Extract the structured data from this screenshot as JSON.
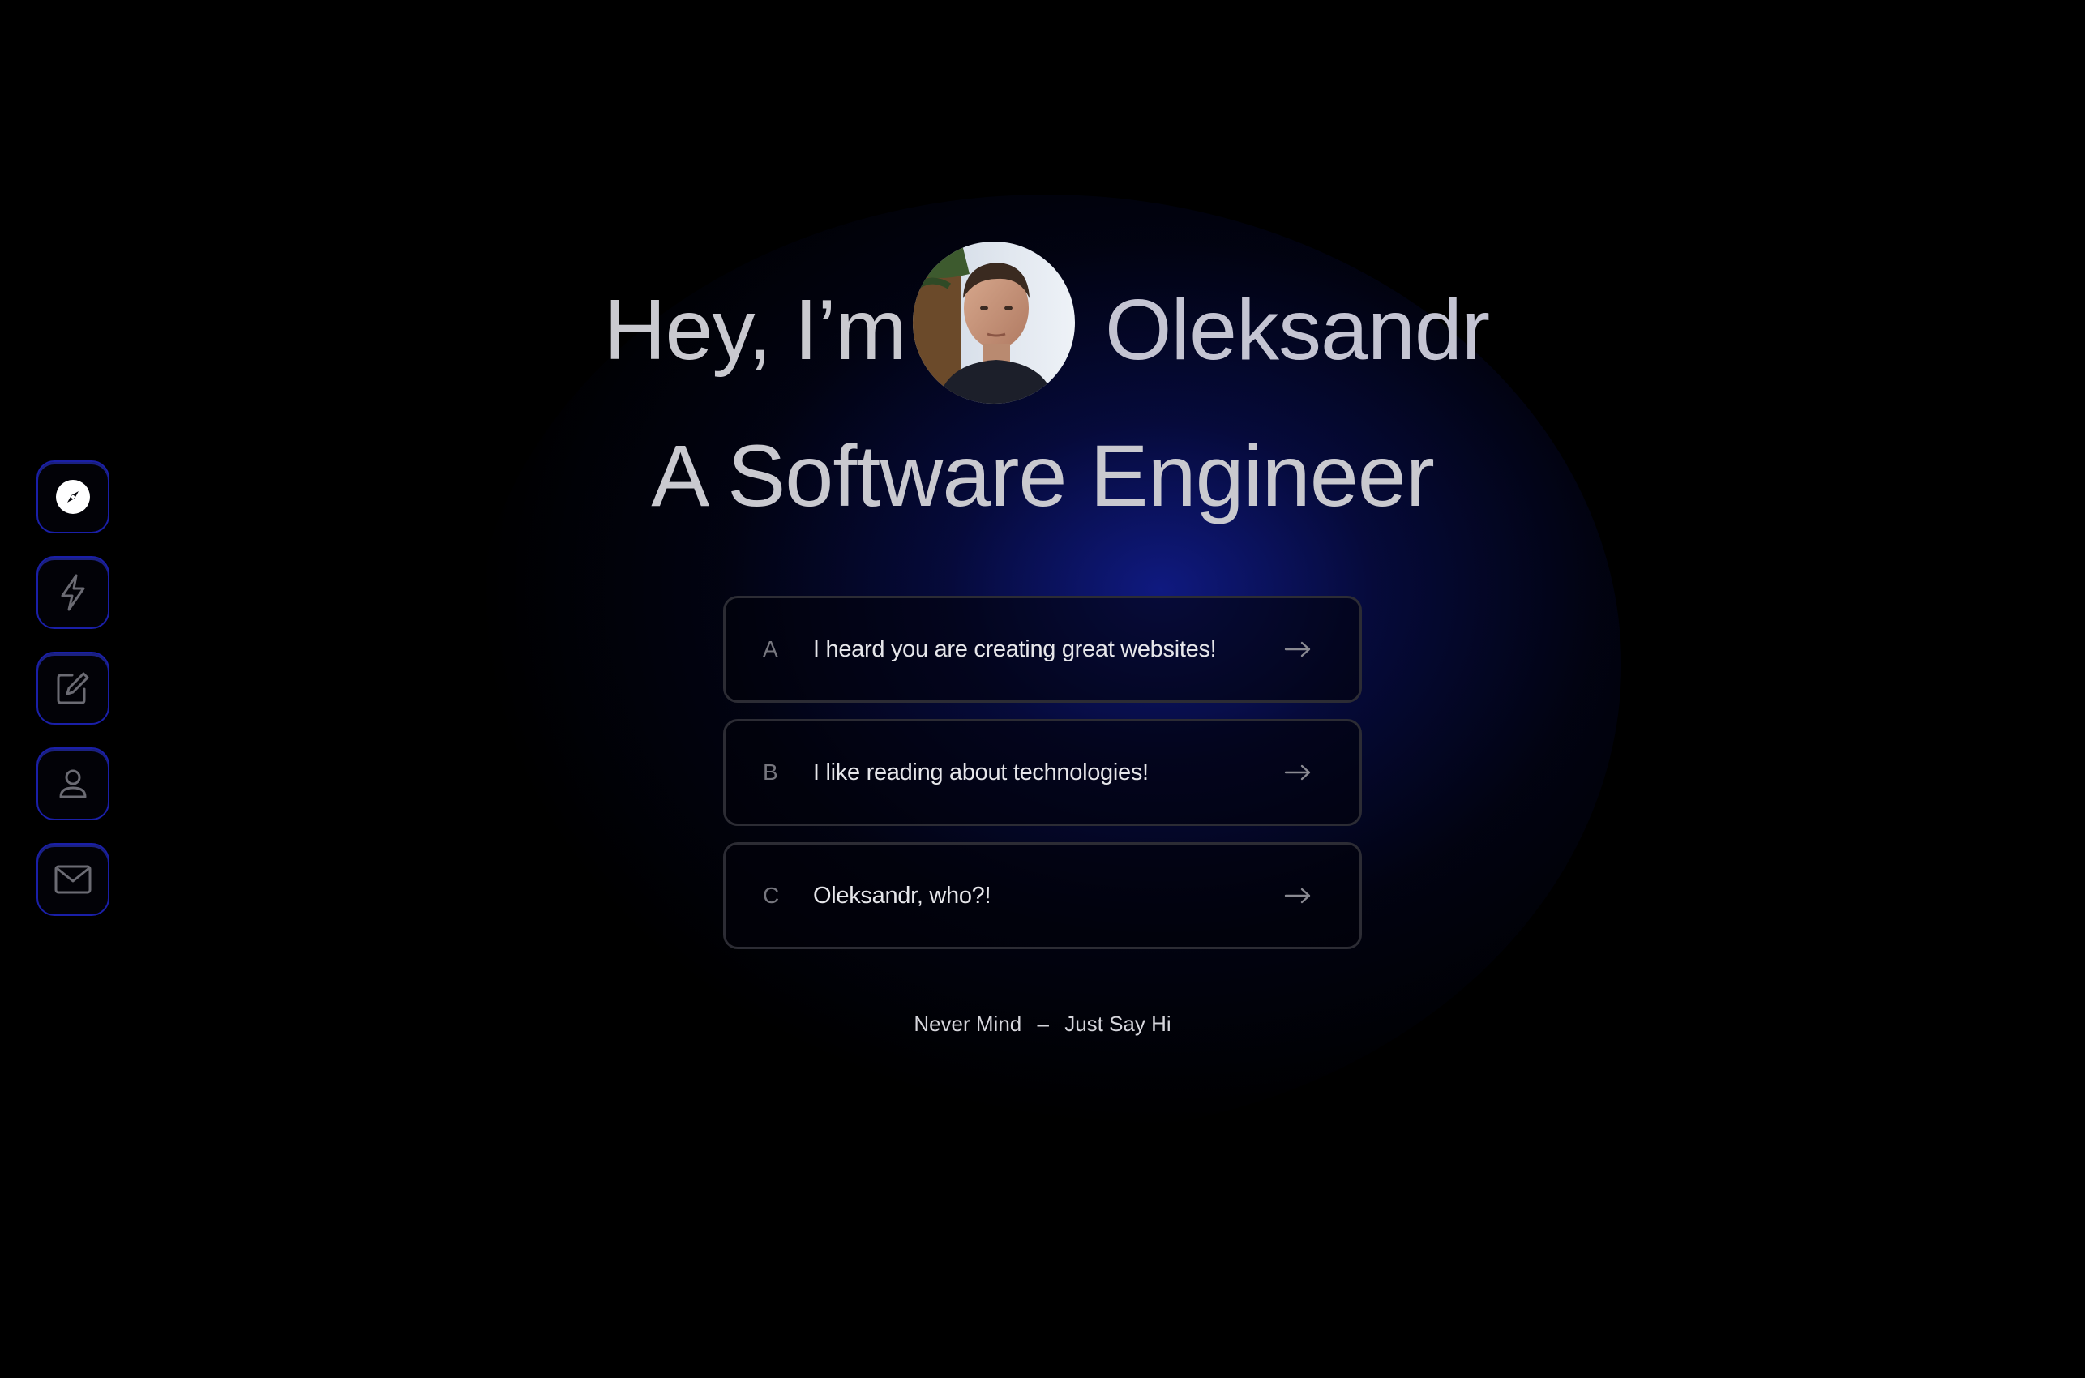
{
  "hero": {
    "greeting": "Hey, I’m",
    "name": "Oleksandr",
    "role": "A Software Engineer"
  },
  "sidebar": {
    "items": [
      {
        "icon": "compass-icon",
        "active": true
      },
      {
        "icon": "lightning-icon",
        "active": false
      },
      {
        "icon": "edit-icon",
        "active": false
      },
      {
        "icon": "user-icon",
        "active": false
      },
      {
        "icon": "mail-icon",
        "active": false
      }
    ]
  },
  "options": [
    {
      "letter": "A",
      "text": "I heard you are creating great websites!"
    },
    {
      "letter": "B",
      "text": "I like reading about technologies!"
    },
    {
      "letter": "C",
      "text": "Oleksandr, who?!"
    }
  ],
  "footer": {
    "prefix": "Never Mind",
    "separator": "–",
    "action": "Just Say Hi"
  },
  "colors": {
    "background": "#000000",
    "accent_blue": "#1a1fa8",
    "text": "#c9c9cf"
  }
}
